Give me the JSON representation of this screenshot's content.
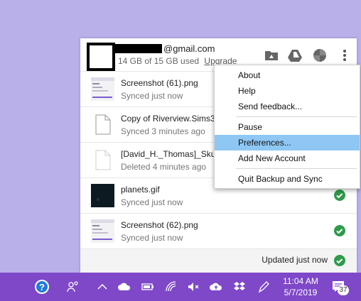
{
  "header": {
    "email": "@gmail.com",
    "usage": "14 GB of 15 GB used",
    "upgrade_label": "Upgrade"
  },
  "files": [
    {
      "name": "Screenshot (61).png",
      "status": "Synced just now",
      "thumb": "screenshot",
      "check": false
    },
    {
      "name": "Copy of Riverview.Sims3",
      "status": "Synced 3 minutes ago",
      "thumb": "doc",
      "check": false
    },
    {
      "name": "[David_H._Thomas]_Sku",
      "status": "Deleted 4 minutes ago",
      "thumb": "doc-light",
      "check": false
    },
    {
      "name": "planets.gif",
      "status": "Synced just now",
      "thumb": "dark",
      "check": true
    },
    {
      "name": "Screenshot (62).png",
      "status": "Synced just now",
      "thumb": "screenshot",
      "check": true
    }
  ],
  "footer": {
    "status": "Updated just now"
  },
  "menu": {
    "items": [
      "About",
      "Help",
      "Send feedback...",
      "Pause",
      "Preferences...",
      "Add New Account",
      "Quit Backup and Sync"
    ],
    "selected": "Preferences..."
  },
  "taskbar": {
    "time": "11:04 AM",
    "date": "5/7/2019",
    "notification_count": "37"
  },
  "colors": {
    "accent": "#7e48c8",
    "check_green": "#2e9a4a",
    "selection": "#8ec7f4"
  }
}
